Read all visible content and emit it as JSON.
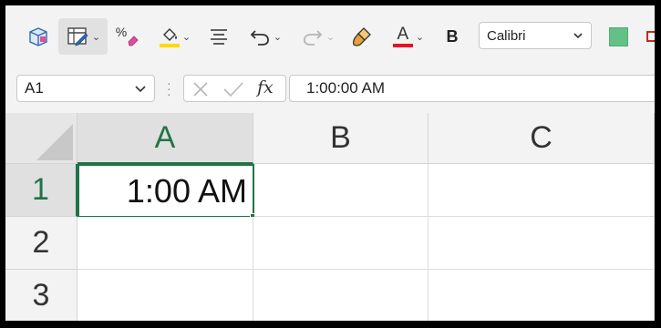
{
  "toolbar": {
    "bold_label": "B",
    "font_name": "Calibri",
    "percent_label": "%",
    "font_color_label": "A",
    "accent_colors": {
      "highlight": "#ffd800",
      "font_color": "#e81123",
      "fill_swatch": "#63c186"
    }
  },
  "formula_bar": {
    "name_box": "A1",
    "fx_label": "fx",
    "formula": "1:00:00 AM"
  },
  "grid": {
    "columns": [
      "A",
      "B",
      "C"
    ],
    "rows": [
      "1",
      "2",
      "3"
    ],
    "active_cell_value": "1:00 AM",
    "selection_color": "#217346"
  }
}
